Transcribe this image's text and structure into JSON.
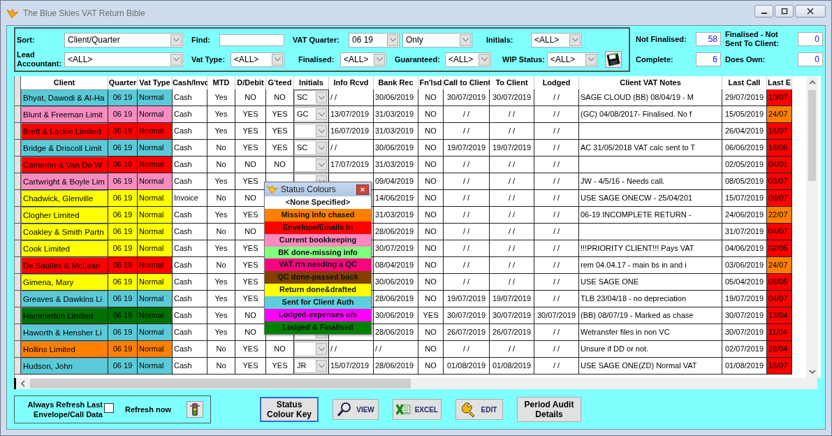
{
  "window": {
    "title": "The Blue Skies VAT Return Bible"
  },
  "filters": {
    "sort": {
      "label": "Sort:",
      "value": "Client/Quarter"
    },
    "find": {
      "label": "Find:"
    },
    "vat_quarter": {
      "label": "VAT Quarter:",
      "value": "06 19",
      "mode": "Only"
    },
    "initials": {
      "label": "Initials:",
      "value": "<ALL>"
    },
    "lead_accountant": {
      "label": "Lead Accountant:",
      "value": "<ALL>"
    },
    "vat_type": {
      "label": "Vat Type:",
      "value": "<ALL>"
    },
    "finalised": {
      "label": "Finalised:",
      "value": "<ALL>"
    },
    "guaranteed": {
      "label": "Guaranteed:",
      "value": "<ALL>"
    },
    "wip_status": {
      "label": "WIP Status:",
      "value": "<ALL>"
    }
  },
  "stats": [
    {
      "label": "Not Finalised:",
      "value": "58"
    },
    {
      "label": "Finalised - Not Sent To Client:",
      "value": "0"
    },
    {
      "label": "Complete:",
      "value": "6"
    },
    {
      "label": "Does Own:",
      "value": "0"
    }
  ],
  "table": {
    "columns": [
      "Client",
      "Quarter",
      "Vat Type",
      "Cash/Invc",
      "MTD",
      "D/Debit",
      "G'teed",
      "Initials",
      "Info Rcvd",
      "Bank Rec",
      "Fn'lsd",
      "Call to Client",
      "To Client",
      "Lodged",
      "Client VAT Notes",
      "Last Call",
      "Last E"
    ],
    "rows": [
      {
        "color": "#5bcad8",
        "client": "Bhyat, Dawodi & Al-Ha",
        "quarter": "06 19",
        "vat_type": "Normal",
        "cash_invc": "Cash",
        "mtd": "Yes",
        "d_debit": "NO",
        "gteed": "NO",
        "initials": "SC",
        "info_rcvd": "/ /",
        "bank_rec": "30/06/2019",
        "fnlsd": "NO",
        "call_to_client": "30/07/2019",
        "to_client": "30/07/2019",
        "lodged": "/ /",
        "notes": "SAGE CLOUD   (BB) 08/04/19 - M",
        "last_call": "29/07/2019",
        "last_e": {
          "value": "10/07",
          "color": "#ff0000"
        }
      },
      {
        "color": "#f78cc0",
        "client": "Blunt & Freeman Limit",
        "quarter": "06 19",
        "vat_type": "Normal",
        "cash_invc": "Cash",
        "mtd": "Yes",
        "d_debit": "YES",
        "gteed": "YES",
        "initials": "GC",
        "info_rcvd": "13/07/2019",
        "bank_rec": "31/03/2019",
        "fnlsd": "NO",
        "call_to_client": "/ /",
        "to_client": "/ /",
        "lodged": "/ /",
        "notes": "(GC) 04/08/2017- Finalised. No f",
        "last_call": "15/05/2019",
        "last_e": {
          "value": "24/07",
          "color": "#ff8000"
        }
      },
      {
        "color": "#ff0000",
        "client": "Brett & Lackie Limited",
        "quarter": "06 19",
        "vat_type": "Normal",
        "cash_invc": "Cash",
        "mtd": "Yes",
        "d_debit": "YES",
        "gteed": "YES",
        "info_rcvd": "16/07/2019",
        "bank_rec": "31/03/2019",
        "fnlsd": "NO",
        "call_to_client": "/ /",
        "to_client": "/ /",
        "lodged": "/ /",
        "last_call": "26/04/2019",
        "last_e": {
          "value": "16/07",
          "color": "#ff0000"
        }
      },
      {
        "color": "#5bcad8",
        "client": "Bridge & Driscoll Limit",
        "quarter": "06 19",
        "vat_type": "Normal",
        "cash_invc": "Cash",
        "mtd": "No",
        "d_debit": "YES",
        "gteed": "YES",
        "initials": "SC",
        "info_rcvd": "/ /",
        "bank_rec": "30/06/2019",
        "fnlsd": "NO",
        "call_to_client": "19/07/2019",
        "to_client": "19/07/2019",
        "lodged": "/ /",
        "notes": "AC 31/05/2018 VAT calc sent to T",
        "last_call": "06/06/2019",
        "last_e": {
          "value": "18/06",
          "color": "#ff0000"
        }
      },
      {
        "color": "#ff0000",
        "client": "Cameron & Van De W",
        "quarter": "06 19",
        "vat_type": "Normal",
        "cash_invc": "Cash",
        "mtd": "No",
        "d_debit": "NO",
        "gteed": "NO",
        "info_rcvd": "17/07/2019",
        "bank_rec": "31/03/2019",
        "fnlsd": "NO",
        "call_to_client": "/ /",
        "to_client": "/ /",
        "lodged": "/ /",
        "last_call": "02/05/2019",
        "last_e": {
          "value": "04/01",
          "color": "#ff0000"
        }
      },
      {
        "color": "#f78cc0",
        "client": "Cartwright & Boyle Lim",
        "quarter": "06 19",
        "vat_type": "Normal",
        "cash_invc": "Cash",
        "mtd": "Yes",
        "d_debit": "YES",
        "bank_rec": "09/04/2019",
        "fnlsd": "NO",
        "call_to_client": "/ /",
        "to_client": "/ /",
        "lodged": "/ /",
        "notes": "JW - 4/5/16 - Needs call.",
        "last_call": "08/05/2019",
        "last_e": {
          "value": "03/07",
          "color": "#ff0000"
        }
      },
      {
        "color": "#ffff00",
        "client": "Chadwick, Glenville",
        "quarter": "06 19",
        "vat_type": "Normal",
        "cash_invc": "Invoice",
        "mtd": "No",
        "d_debit": "NO",
        "bank_rec": "14/06/2019",
        "fnlsd": "NO",
        "call_to_client": "/ /",
        "to_client": "/ /",
        "lodged": "/ /",
        "notes": "USE SAGE ONECW - 25/04/201",
        "last_call": "15/07/2019",
        "last_e": {
          "value": "08/07",
          "color": "#ff0000"
        }
      },
      {
        "color": "#ffff00",
        "client": "Clogher Limited",
        "quarter": "06 19",
        "vat_type": "Normal",
        "cash_invc": "Cash",
        "mtd": "Yes",
        "d_debit": "YES",
        "bank_rec": "31/03/2019",
        "fnlsd": "NO",
        "call_to_client": "/ /",
        "to_client": "/ /",
        "lodged": "/ /",
        "notes": "06-19 INCOMPLETE RETURN -",
        "last_call": "24/06/2019",
        "last_e": {
          "value": "22/07",
          "color": "#ff8000"
        }
      },
      {
        "color": "#ffff00",
        "client": "Coakley & Smith Partn",
        "quarter": "06 19",
        "vat_type": "Normal",
        "cash_invc": "Cash",
        "mtd": "No",
        "d_debit": "NO",
        "bank_rec": "28/06/2019",
        "fnlsd": "NO",
        "call_to_client": "/ /",
        "to_client": "/ /",
        "lodged": "/ /",
        "last_call": "31/07/2019",
        "last_e": {
          "value": "04/07",
          "color": "#ff0000"
        }
      },
      {
        "color": "#ffff00",
        "client": "Cook Limited",
        "quarter": "06 19",
        "vat_type": "Normal",
        "cash_invc": "Cash",
        "mtd": "Yes",
        "d_debit": "YES",
        "bank_rec": "30/07/2019",
        "fnlsd": "NO",
        "call_to_client": "/ /",
        "to_client": "/ /",
        "lodged": "/ /",
        "notes": "!!!PRIORITY CLIENT!!!  Pays VAT",
        "last_call": "04/06/2019",
        "last_e": {
          "value": "02/05",
          "color": "#ff0000"
        }
      },
      {
        "color": "#ff0000",
        "client": "De Saulles & McLean",
        "quarter": "06 19",
        "vat_type": "Normal",
        "cash_invc": "Cash",
        "mtd": "No",
        "d_debit": "YES",
        "bank_rec": "08/04/2019",
        "fnlsd": "NO",
        "call_to_client": "/ /",
        "to_client": "/ /",
        "lodged": "/ /",
        "notes": "rem 04.04.17  - main bs in and i",
        "last_call": "03/06/2019",
        "last_e": {
          "value": "24/07",
          "color": "#ff8000"
        }
      },
      {
        "color": "#ffff00",
        "client": "Gimena, Mary",
        "quarter": "06 19",
        "vat_type": "Normal",
        "cash_invc": "Cash",
        "mtd": "Yes",
        "d_debit": "YES",
        "bank_rec": "30/06/2019",
        "fnlsd": "NO",
        "call_to_client": "/ /",
        "to_client": "/ /",
        "lodged": "/ /",
        "notes": "USE SAGE ONE",
        "last_call": "05/04/2019",
        "last_e": {
          "value": "08/05",
          "color": "#ff0000"
        }
      },
      {
        "color": "#5bcad8",
        "client": "Greaves & Dawkins Li",
        "quarter": "06 19",
        "vat_type": "Normal",
        "cash_invc": "Cash",
        "mtd": "Yes",
        "d_debit": "YES",
        "bank_rec": "28/06/2019",
        "fnlsd": "NO",
        "call_to_client": "19/07/2019",
        "to_client": "19/07/2019",
        "lodged": "/ /",
        "notes": "TLB  23/04/18 - no depreciation",
        "last_call": "19/07/2019",
        "last_e": {
          "value": "04/07",
          "color": "#ff0000"
        }
      },
      {
        "color": "#007000",
        "client": "Hammerton Limited",
        "quarter": "06 19",
        "vat_type": "Normal",
        "cash_invc": "Cash",
        "mtd": "Yes",
        "d_debit": "NO",
        "bank_rec": "30/06/2019",
        "fnlsd": "YES",
        "call_to_client": "30/07/2019",
        "to_client": "30/07/2019",
        "lodged": "30/07/2019",
        "notes": "(BB) 08/07/19 - Marked as chase",
        "last_call": "30/07/2019",
        "last_e": {
          "value": "13/04",
          "color": "#ff0000"
        }
      },
      {
        "color": "#5bcad8",
        "client": "Haworth & Hensher Li",
        "quarter": "06 19",
        "vat_type": "Normal",
        "cash_invc": "Cash",
        "mtd": "Yes",
        "d_debit": "NO",
        "bank_rec": "28/06/2019",
        "fnlsd": "NO",
        "call_to_client": "26/07/2019",
        "to_client": "26/07/2019",
        "lodged": "/ /",
        "notes": "Wetransfer files in non VC",
        "last_call": "30/07/2019",
        "last_e": {
          "value": "11/04",
          "color": "#ff0000"
        }
      },
      {
        "color": "#ff8000",
        "client": "Hollins Limited",
        "quarter": "06 19",
        "vat_type": "Normal",
        "cash_invc": "Cash",
        "mtd": "No",
        "d_debit": "YES",
        "gteed": "NO",
        "info_rcvd": "/ /",
        "bank_rec": "/ /",
        "fnlsd": "NO",
        "call_to_client": "/ /",
        "to_client": "/ /",
        "lodged": "/ /",
        "notes": "Unsure if DD or not.",
        "last_call": "02/07/2019",
        "last_e": {
          "value": "26/04",
          "color": "#ff0000"
        }
      },
      {
        "color": "#5bcad8",
        "client": "Hudson, John",
        "quarter": "06 19",
        "vat_type": "Normal",
        "cash_invc": "Cash",
        "mtd": "No",
        "d_debit": "YES",
        "gteed": "YES",
        "initials": "JR",
        "info_rcvd": "15/07/2019",
        "bank_rec": "28/06/2019",
        "fnlsd": "NO",
        "call_to_client": "01/08/2019",
        "to_client": "01/08/2019",
        "lodged": "/ /",
        "notes": "USE SAGE ONE(ZD) Normal VAT",
        "last_call": "01/08/2019",
        "last_e": {
          "value": "15/07",
          "color": "#ff0000"
        }
      }
    ]
  },
  "status_popup": {
    "title": "Status Colours",
    "close": "×",
    "items": [
      {
        "label": "<None Specified>",
        "color": "#ffffff"
      },
      {
        "label": "Missing Info chased",
        "color": "#ff8000"
      },
      {
        "label": "Envelope/Emails In",
        "color": "#ff0000"
      },
      {
        "label": "Current bookkeeping",
        "color": "#ff88c0"
      },
      {
        "label": "BK done-missing info",
        "color": "#80ff80"
      },
      {
        "label": "VAT rtn needing a QC",
        "color": "#ff0080"
      },
      {
        "label": "QC done-passed back",
        "color": "#804000"
      },
      {
        "label": "Return done&drafted",
        "color": "#ffff00"
      },
      {
        "label": "Sent for Client Auth",
        "color": "#5ccfdc"
      },
      {
        "label": "Lodged-expenses o/s",
        "color": "#ff00ff"
      },
      {
        "label": "Lodged & Finalised",
        "color": "#008000"
      }
    ]
  },
  "refresh": {
    "always_label": "Always Refresh Last Envelope/Call Data",
    "always_checked": false,
    "now_label": "Refresh now"
  },
  "buttons": [
    {
      "kind": "status",
      "label": "Status Colour Key",
      "focused": true
    },
    {
      "kind": "view",
      "label": "VIEW",
      "focused": false
    },
    {
      "kind": "excel",
      "label": "EXCEL",
      "focused": false
    },
    {
      "kind": "edit",
      "label": "EDIT",
      "focused": false
    },
    {
      "kind": "audit",
      "label": "Period Audit Details",
      "focused": false
    }
  ]
}
